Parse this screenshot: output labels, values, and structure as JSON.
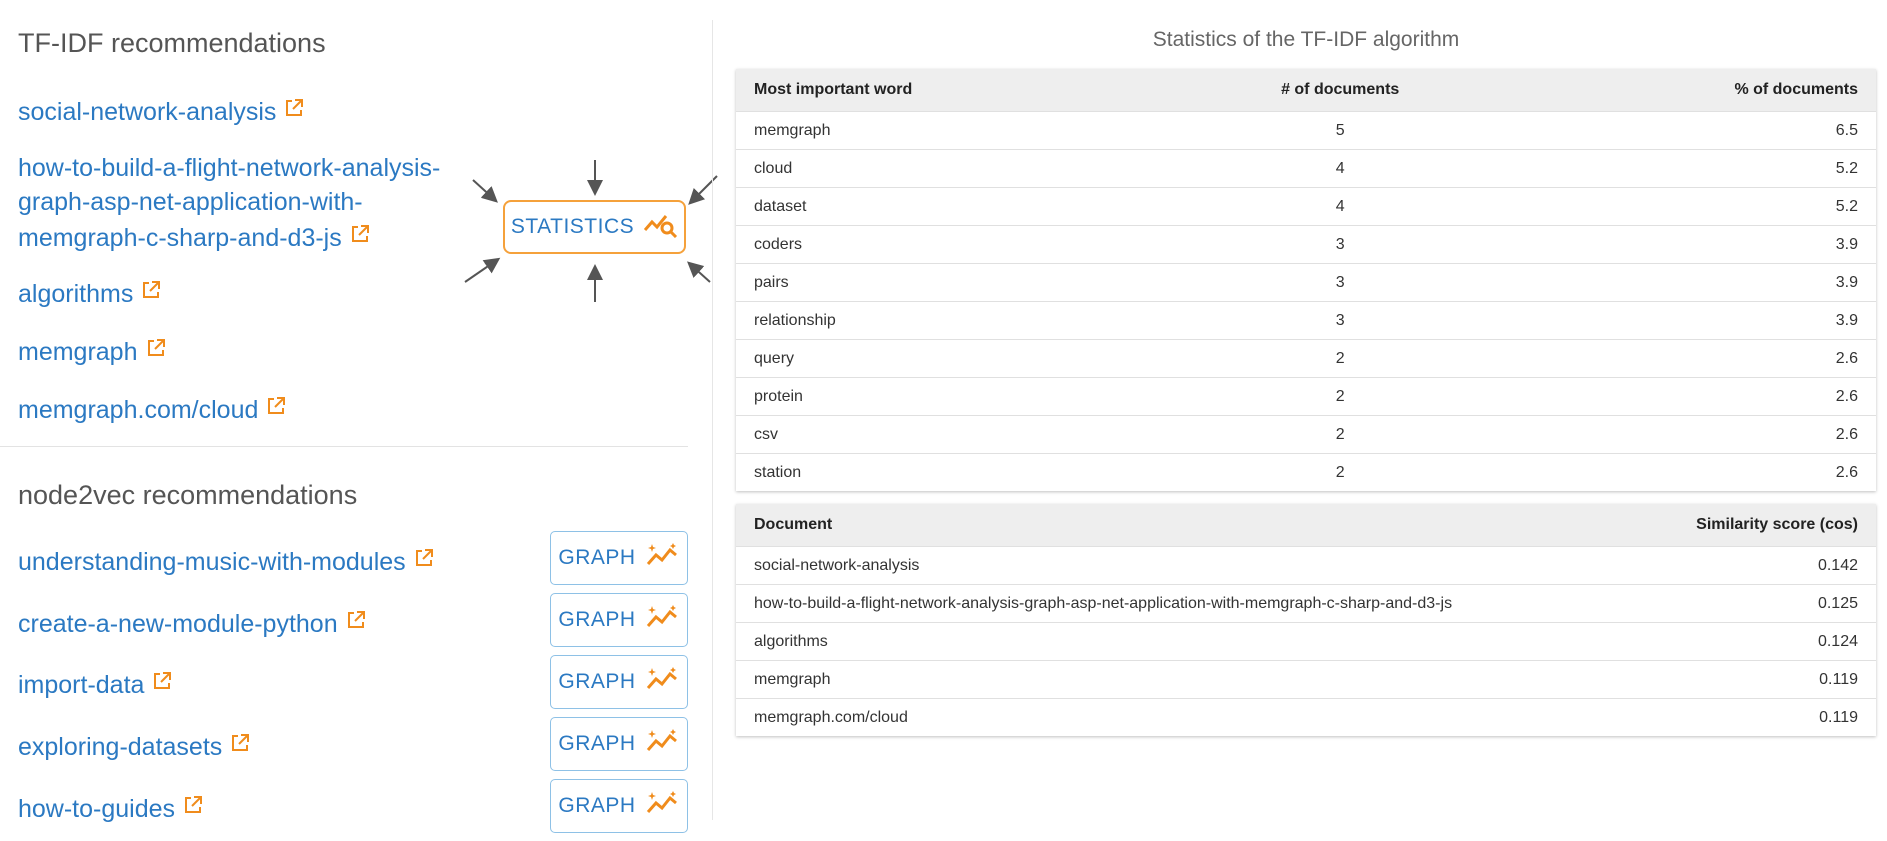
{
  "tfidf": {
    "title": "TF-IDF recommendations",
    "links": [
      {
        "label": "social-network-analysis"
      },
      {
        "label": "how-to-build-a-flight-network-analysis-graph-asp-net-application-with-memgraph-c-sharp-and-d3-js"
      },
      {
        "label": "algorithms"
      },
      {
        "label": "memgraph"
      },
      {
        "label": "memgraph.com/cloud"
      }
    ],
    "statistics_button": "STATISTICS"
  },
  "node2vec": {
    "title": "node2vec recommendations",
    "links": [
      {
        "label": "understanding-music-with-modules"
      },
      {
        "label": "create-a-new-module-python"
      },
      {
        "label": "import-data"
      },
      {
        "label": "exploring-datasets"
      },
      {
        "label": "how-to-guides"
      }
    ],
    "graph_button": "GRAPH"
  },
  "statistics": {
    "title": "Statistics of the TF-IDF algorithm",
    "words_table": {
      "headers": [
        "Most important word",
        "# of documents",
        "% of documents"
      ],
      "rows": [
        [
          "memgraph",
          "5",
          "6.5"
        ],
        [
          "cloud",
          "4",
          "5.2"
        ],
        [
          "dataset",
          "4",
          "5.2"
        ],
        [
          "coders",
          "3",
          "3.9"
        ],
        [
          "pairs",
          "3",
          "3.9"
        ],
        [
          "relationship",
          "3",
          "3.9"
        ],
        [
          "query",
          "2",
          "2.6"
        ],
        [
          "protein",
          "2",
          "2.6"
        ],
        [
          "csv",
          "2",
          "2.6"
        ],
        [
          "station",
          "2",
          "2.6"
        ]
      ]
    },
    "docs_table": {
      "headers": [
        "Document",
        "Similarity score (cos)"
      ],
      "rows": [
        [
          "social-network-analysis",
          "0.142"
        ],
        [
          "how-to-build-a-flight-network-analysis-graph-asp-net-application-with-memgraph-c-sharp-and-d3-js",
          "0.125"
        ],
        [
          "algorithms",
          "0.124"
        ],
        [
          "memgraph",
          "0.119"
        ],
        [
          "memgraph.com/cloud",
          "0.119"
        ]
      ]
    }
  },
  "colors": {
    "link": "#2b79c2",
    "accent_orange": "#f5a13b",
    "graph_button_border": "#8ec1e6"
  },
  "icons": {
    "external_link": "external-link-icon",
    "statistics": "chart-search-icon",
    "graph": "sparkle-chart-icon"
  }
}
